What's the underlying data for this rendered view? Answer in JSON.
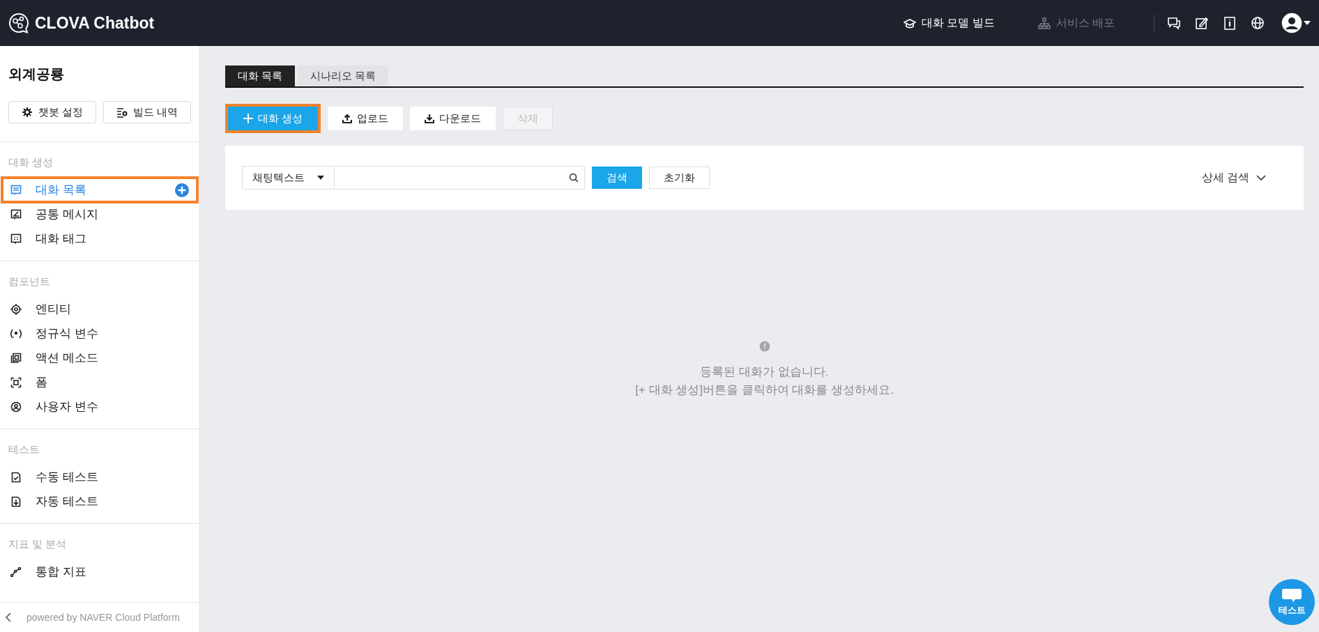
{
  "header": {
    "logo": "CLOVA Chatbot",
    "nav": [
      {
        "label": "대화 모델 빌드",
        "disabled": false
      },
      {
        "label": "서비스 배포",
        "disabled": true
      }
    ]
  },
  "sidebar": {
    "title": "외계공룡",
    "buttons": [
      "챗봇 설정",
      "빌드 내역"
    ],
    "sections": [
      {
        "heading": "대화 생성",
        "items": [
          {
            "label": "대화 목록",
            "selected": true,
            "highlighted": true
          },
          {
            "label": "공통 메시지",
            "selected": false,
            "highlighted": false
          },
          {
            "label": "대화 태그",
            "selected": false,
            "highlighted": false
          }
        ]
      },
      {
        "heading": "컴포넌트",
        "items": [
          {
            "label": "엔티티",
            "selected": false,
            "highlighted": false
          },
          {
            "label": "정규식 변수",
            "selected": false,
            "highlighted": false
          },
          {
            "label": "액션 메소드",
            "selected": false,
            "highlighted": false
          },
          {
            "label": "폼",
            "selected": false,
            "highlighted": false
          },
          {
            "label": "사용자 변수",
            "selected": false,
            "highlighted": false
          }
        ]
      },
      {
        "heading": "테스트",
        "items": [
          {
            "label": "수동 테스트",
            "selected": false,
            "highlighted": false
          },
          {
            "label": "자동 테스트",
            "selected": false,
            "highlighted": false
          }
        ]
      },
      {
        "heading": "지표 및 분석",
        "items": [
          {
            "label": "통합 지표",
            "selected": false,
            "highlighted": false
          }
        ]
      }
    ],
    "footer": "powered by NAVER Cloud Platform"
  },
  "tabs": [
    {
      "label": "대화 목록",
      "selected": true
    },
    {
      "label": "시나리오 목록",
      "selected": false
    }
  ],
  "toolbar": [
    {
      "label": "대화 생성",
      "kind": "primary",
      "disabled": false,
      "highlighted": true
    },
    {
      "label": "업로드",
      "kind": "default",
      "disabled": false,
      "highlighted": false
    },
    {
      "label": "다운로드",
      "kind": "default",
      "disabled": false,
      "highlighted": false
    },
    {
      "label": "삭제",
      "kind": "default",
      "disabled": true,
      "highlighted": false
    }
  ],
  "search": {
    "filter": "채팅텍스트",
    "buttons": [
      {
        "label": "검색",
        "kind": "primary"
      },
      {
        "label": "초기화",
        "kind": "default"
      }
    ],
    "advanced": "상세 검색"
  },
  "empty_state": {
    "lines": [
      "등록된 대화가 없습니다.",
      "[+ 대화 생성]버튼을 클릭하여 대화를 생성하세요."
    ]
  },
  "chat_button": {
    "label": "테스트"
  }
}
